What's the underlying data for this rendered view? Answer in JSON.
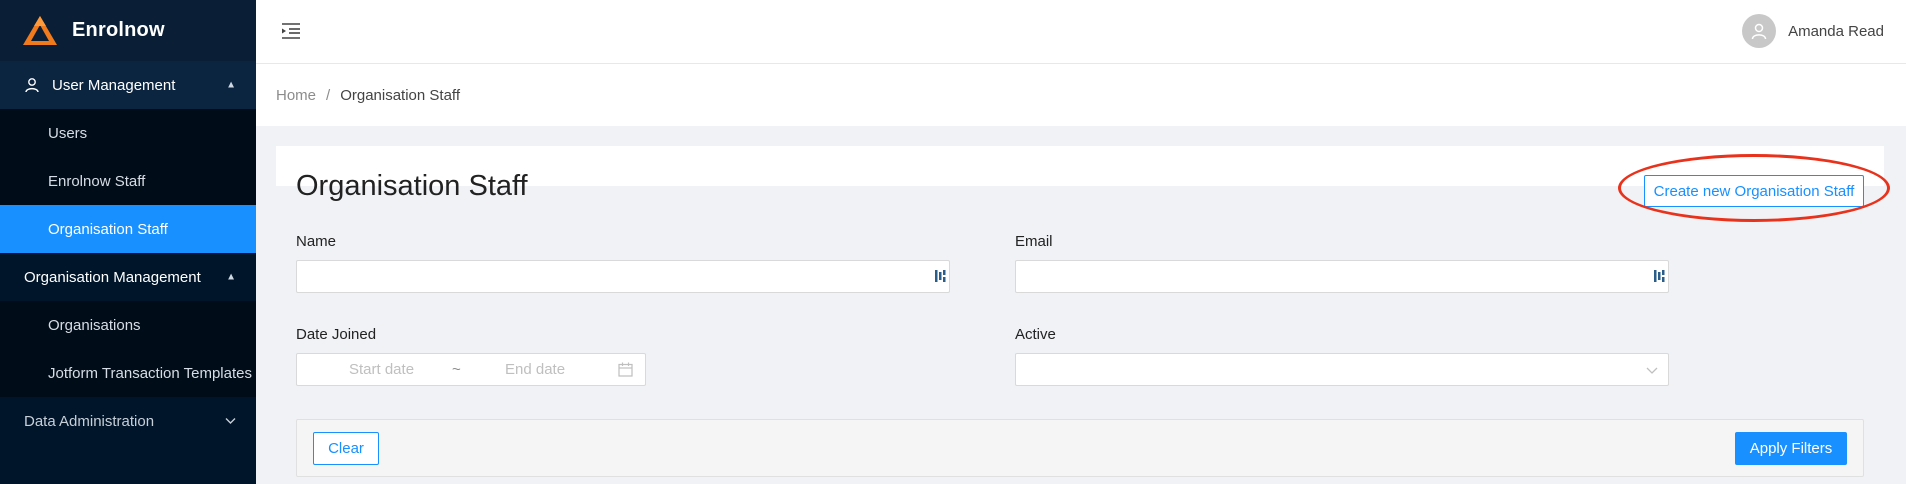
{
  "brand": {
    "name": "Enrolnow",
    "logo_icon": "enrolnow-logo-icon",
    "accent": "#f07a1c"
  },
  "sidebar": {
    "groups": [
      {
        "label": "User Management",
        "icon": "user-icon",
        "expanded": true,
        "items": [
          {
            "label": "Users",
            "active": false
          },
          {
            "label": "Enrolnow Staff",
            "active": false
          },
          {
            "label": "Organisation Staff",
            "active": true
          }
        ]
      },
      {
        "label": "Organisation Management",
        "expanded": true,
        "items": [
          {
            "label": "Organisations",
            "active": false
          },
          {
            "label": "Jotform Transaction Templates",
            "active": false
          }
        ]
      },
      {
        "label": "Data Administration",
        "expanded": false,
        "items": []
      }
    ]
  },
  "header": {
    "menu_fold_icon": "menu-fold-icon",
    "user_name": "Amanda Read",
    "avatar_icon": "user-avatar-icon"
  },
  "breadcrumb": {
    "home": "Home",
    "separator": "/",
    "current": "Organisation Staff"
  },
  "page": {
    "title": "Organisation Staff",
    "create_button": "Create new Organisation Staff"
  },
  "filters": {
    "name": {
      "label": "Name",
      "value": ""
    },
    "email": {
      "label": "Email",
      "value": ""
    },
    "date_joined": {
      "label": "Date Joined",
      "start_placeholder": "Start date",
      "separator": "~",
      "end_placeholder": "End date"
    },
    "active": {
      "label": "Active",
      "value": ""
    },
    "clear_button": "Clear",
    "apply_button": "Apply Filters"
  },
  "colors": {
    "primary": "#1890ff",
    "sidebar_bg": "#001529",
    "annotation": "#e8321c"
  }
}
